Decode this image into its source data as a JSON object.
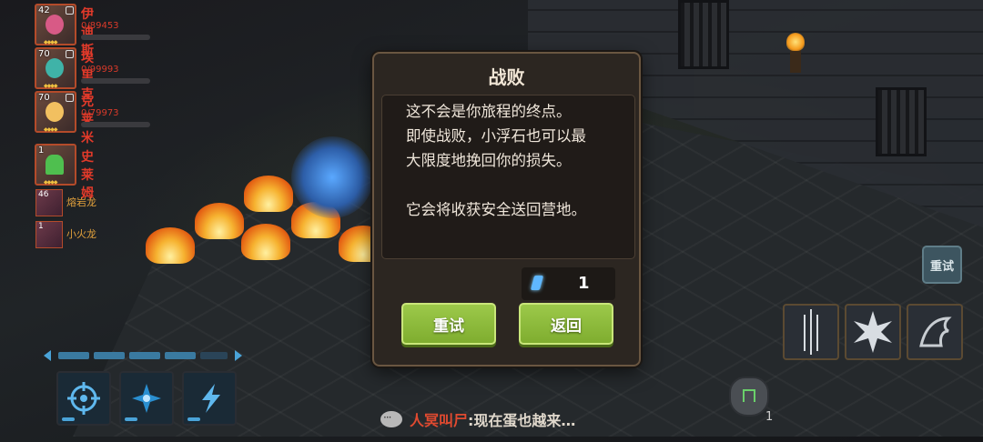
{
  "party": [
    {
      "level": "42",
      "name": "伊迪斯",
      "hp": "0/89453",
      "face_color": "#d85a86"
    },
    {
      "level": "70",
      "name": "埃里克",
      "hp": "0/99993",
      "face_color": "#3fb3a8"
    },
    {
      "level": "70",
      "name": "克莱米",
      "hp": "0/79973",
      "face_color": "#f2c060"
    },
    {
      "level": "1",
      "name": "史莱姆",
      "hp": "",
      "face_color": "#4fbf4f"
    }
  ],
  "pets": [
    {
      "level": "46",
      "name": "熔岩龙"
    },
    {
      "level": "1",
      "name": "小火龙"
    }
  ],
  "dialog": {
    "title": "战败",
    "lines": [
      "这不会是你旅程的终点。",
      "即使战败，小浮石也可以最",
      "大限度地挽回你的损失。",
      "它会将收获安全送回营地。"
    ],
    "reward_count": "1",
    "retry_label": "重试",
    "return_label": "返回"
  },
  "side_retry_label": "重试",
  "chat": {
    "speaker": "人冥叫尸",
    "message": ":现在蛋也越来…"
  },
  "rune_count": "1",
  "colors": {
    "button_green": "#8fbb3c",
    "name_red": "#e23a2a",
    "pet_gold": "#e2a13c"
  }
}
